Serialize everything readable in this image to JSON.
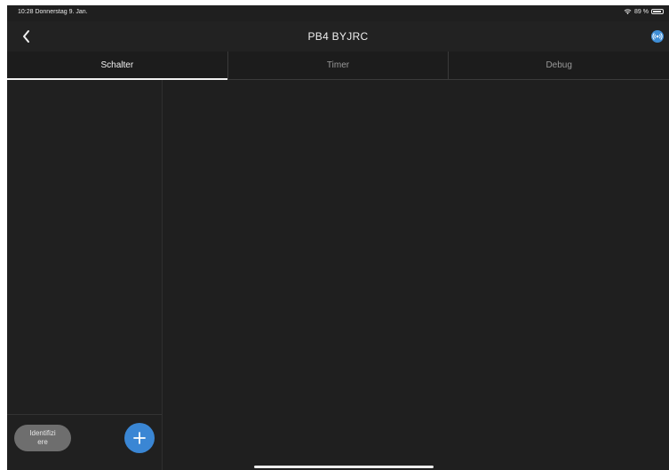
{
  "statusbar": {
    "time_date": "10:28  Donnerstag 9. Jan.",
    "battery_percent": "89 %",
    "battery_level": 0.89
  },
  "navbar": {
    "title": "PB4 BYJRC",
    "back_icon": "chevron-left-icon",
    "connection_icon": "broadcast-icon"
  },
  "tabs": [
    {
      "label": "Schalter",
      "active": true
    },
    {
      "label": "Timer",
      "active": false
    },
    {
      "label": "Debug",
      "active": false
    }
  ],
  "sidebar": {
    "identify_label": "Identifizi ere",
    "add_icon": "plus-icon"
  },
  "colors": {
    "background": "#1f1f1f",
    "accent": "#3a86d4",
    "identify_button": "#6e6e6e"
  }
}
